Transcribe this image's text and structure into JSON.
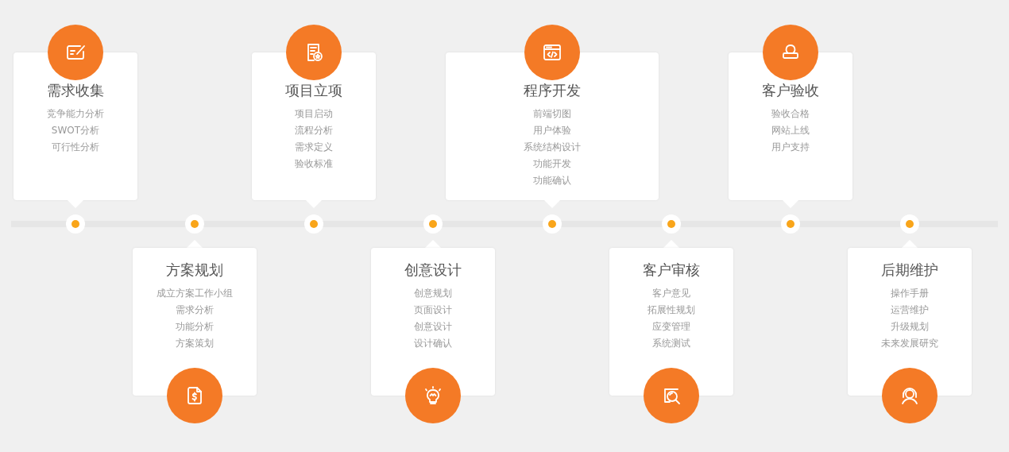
{
  "steps": [
    {
      "title": "需求收集",
      "items": [
        "竞争能力分析",
        "SWOT分析",
        "可行性分析"
      ]
    },
    {
      "title": "方案规划",
      "items": [
        "成立方案工作小组",
        "需求分析",
        "功能分析",
        "方案策划"
      ]
    },
    {
      "title": "项目立项",
      "items": [
        "项目启动",
        "流程分析",
        "需求定义",
        "验收标准"
      ]
    },
    {
      "title": "创意设计",
      "items": [
        "创意规划",
        "页面设计",
        "创意设计",
        "设计确认"
      ]
    },
    {
      "title": "程序开发",
      "items": [
        "前端切图",
        "用户体验",
        "系统结构设计",
        "功能开发",
        "功能确认"
      ]
    },
    {
      "title": "客户审核",
      "items": [
        "客户意见",
        "拓展性规划",
        "应变管理",
        "系统测试"
      ]
    },
    {
      "title": "客户验收",
      "items": [
        "验收合格",
        "网站上线",
        "用户支持"
      ]
    },
    {
      "title": "后期维护",
      "items": [
        "操作手册",
        "运营维护",
        "升级规划",
        "未来发展研究"
      ]
    }
  ]
}
